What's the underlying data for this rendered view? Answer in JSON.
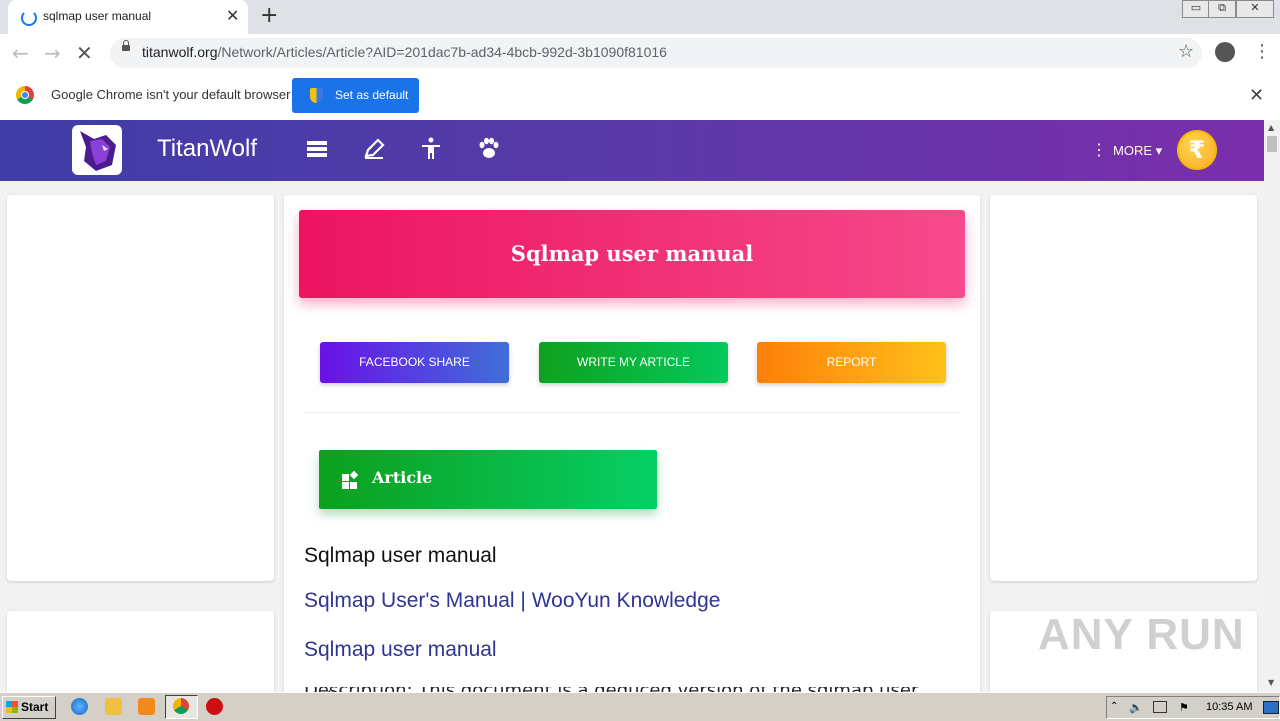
{
  "browser": {
    "tab_title": "sqlmap user manual",
    "tab_close": "✕",
    "new_tab": "+",
    "url_host": "titanwolf.org",
    "url_path": "/Network/Articles/Article?AID=201dac7b-ad34-4bcb-992d-3b1090f81016",
    "window_buttons": [
      "▭",
      "⧉",
      "✕"
    ]
  },
  "infobar": {
    "message": "Google Chrome isn't your default browser",
    "button_label": "Set as default",
    "close": "✕"
  },
  "site": {
    "name": "TitanWolf",
    "more_label": "MORE ▾",
    "coin_symbol": "₹",
    "header_icons": [
      "list-icon",
      "pencil-icon",
      "accessibility-icon",
      "paw-icon"
    ]
  },
  "article": {
    "title": "Sqlmap user manual",
    "buttons": {
      "facebook": "FACEBOOK SHARE",
      "write": "WRITE MY ARTICLE",
      "report": "REPORT"
    },
    "section_label": "Article",
    "heading": "Sqlmap user manual",
    "link_1": "Sqlmap User's Manual | WooYun Knowledge",
    "link_2": "Sqlmap user manual",
    "cut_text": "Description: This document is a deduced version of the sqlmap user guide"
  },
  "watermark": "ANY RUN",
  "taskbar": {
    "start_label": "Start",
    "clock": "10:35 AM"
  },
  "colors": {
    "header_start": "#3f3da6",
    "header_end": "#7b2eab",
    "title_banner": "#ec1461",
    "link": "#2f3592"
  }
}
